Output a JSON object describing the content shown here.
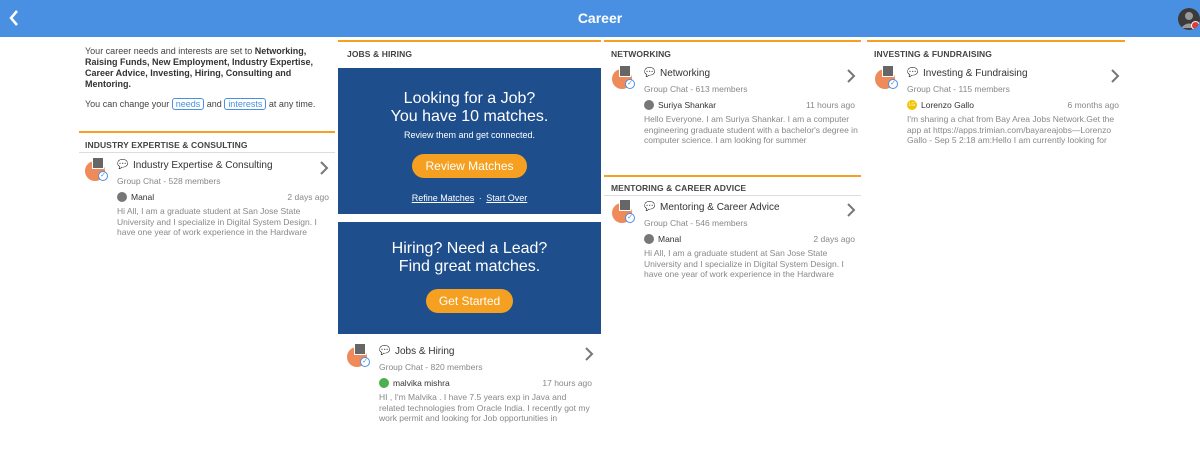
{
  "header": {
    "title": "Career",
    "back_icon": "chevron-left-icon",
    "avatar_icon": "user-avatar-icon"
  },
  "intro": {
    "line1_prefix": "Your career needs and interests are set to ",
    "interests_list": "Networking, Raising Funds, New Employment, Industry Expertise, Career Advice, Investing, Hiring, Consulting and Mentoring.",
    "line2_prefix": "You can change your ",
    "needs_link": "needs",
    "and_text": " and ",
    "interests_link": "interests",
    "line2_suffix": " at any time."
  },
  "sections": {
    "industry": {
      "heading": "INDUSTRY EXPERTISE & CONSULTING",
      "group": "Industry Expertise & Consulting",
      "meta": "Group Chat - 528 members",
      "user": "Manal",
      "time": "2 days ago",
      "message": "Hi All, I am a graduate student at San Jose State University and I specialize in Digital System Design. I have one year of work experience in the Hardware"
    },
    "jobs": {
      "heading": "JOBS & HIRING",
      "group": "Jobs & Hiring",
      "meta": "Group Chat - 820 members",
      "user": "malvika mishra",
      "time": "17 hours ago",
      "message": "HI , I'm Malvika . I have 7.5 years exp in Java and related technologies from Oracle India. I recently got my work permit and looking for Job opportunities in"
    },
    "networking": {
      "heading": "NETWORKING",
      "group": "Networking",
      "meta": "Group Chat - 613 members",
      "user": "Suriya Shankar",
      "time": "11 hours ago",
      "message": "Hello Everyone. I am Suriya Shankar. I am a computer engineering graduate student with a bachelor's degree in computer science. I am looking for summer"
    },
    "mentoring": {
      "heading": "MENTORING & CAREER ADVICE",
      "group": "Mentoring & Career Advice",
      "meta": "Group Chat - 546 members",
      "user": "Manal",
      "time": "2 days ago",
      "message": "Hi All, I am a graduate student at San Jose State University and I specialize in Digital System Design. I have one year of work experience in the Hardware"
    },
    "investing": {
      "heading": "INVESTING & FUNDRAISING",
      "group": "Investing & Fundraising",
      "meta": "Group Chat - 115 members",
      "user": "Lorenzo Gallo",
      "user_initials": "LG",
      "time": "6 months ago",
      "message": "I'm sharing a chat from Bay Area Jobs Network.Get the app at https://apps.trimian.com/bayareajobs—Lorenzo Gallo - Sep 5 2:18 am:Hello I am currently looking for"
    }
  },
  "promo_job": {
    "title_line1": "Looking for a Job?",
    "title_line2": "You have 10 matches.",
    "subtitle": "Review them and get connected.",
    "button": "Review Matches",
    "link_refine": "Refine Matches",
    "link_separator": "·",
    "link_start_over": "Start Over"
  },
  "promo_hiring": {
    "title_line1": "Hiring? Need a Lead?",
    "title_line2": "Find great matches.",
    "button": "Get Started"
  },
  "colors": {
    "topbar": "#4a90e2",
    "accent_orange": "#f5a020",
    "promo_blue": "#1e4e8c"
  }
}
